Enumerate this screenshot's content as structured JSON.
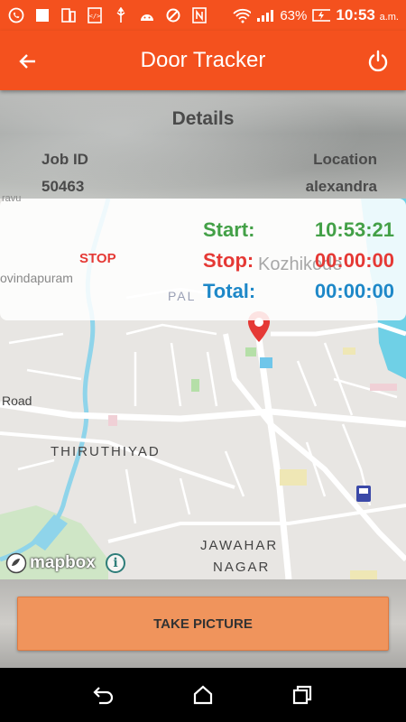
{
  "status_bar": {
    "battery": "63%",
    "time": "10:53",
    "ampm": "a.m.",
    "icons": [
      "whatsapp-icon",
      "notification-icon",
      "tablet-icon",
      "code-icon",
      "usb-icon",
      "android-icon",
      "sync-icon",
      "nfc-icon",
      "wifi-icon",
      "signal-icon",
      "battery-icon"
    ]
  },
  "app_bar": {
    "title": "Door Tracker",
    "back_icon": "arrow-left-icon",
    "power_icon": "power-icon"
  },
  "details": {
    "title": "Details",
    "job_id_label": "Job ID",
    "job_id_value": "50463",
    "location_label": "Location",
    "location_value": "alexandra"
  },
  "timer": {
    "stop_button": "STOP",
    "start_label": "Start:",
    "start_value": "10:53:21",
    "stop_label": "Stop:",
    "stop_value": "00:00:00",
    "total_label": "Total:",
    "total_value": "00:00:00",
    "colors": {
      "start": "#43a047",
      "stop": "#e53935",
      "total": "#1e88c8"
    }
  },
  "map": {
    "labels": {
      "ravu": "ravu",
      "govindapuram": "ovindapuram",
      "kozhikode": "Kozhikode",
      "pal": "PAL",
      "road": "Road",
      "thiruthiyad": "THIRUTHIYAD",
      "jawahar": "JAWAHAR",
      "nagar": "NAGAR"
    },
    "attribution": "mapbox",
    "info_icon": "info-icon",
    "marker_icon": "map-marker-icon"
  },
  "actions": {
    "take_picture": "TAKE PICTURE"
  },
  "nav_bar": {
    "back_icon": "nav-back-icon",
    "home_icon": "nav-home-icon",
    "recents_icon": "nav-recents-icon"
  },
  "colors": {
    "accent": "#f4511e",
    "button": "#f0945c"
  }
}
